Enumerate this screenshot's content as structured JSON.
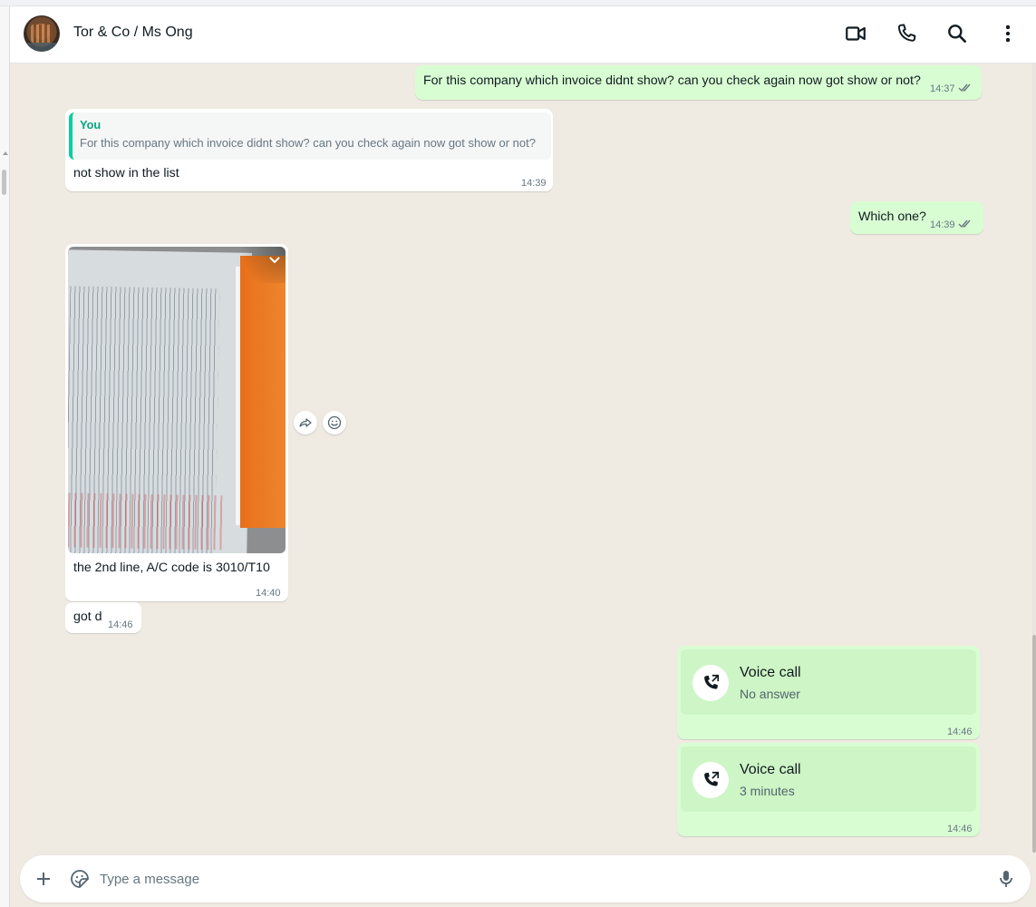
{
  "header": {
    "title": "Tor & Co / Ms Ong",
    "icons": [
      "video-call-icon",
      "voice-call-icon",
      "search-icon",
      "menu-icon"
    ]
  },
  "messages": [
    {
      "direction": "out",
      "text": "For this company which invoice didnt show? can you check again now got show or not?",
      "time": "14:37",
      "status": "read"
    },
    {
      "direction": "in",
      "quote": {
        "author": "You",
        "text": "For this company which invoice didnt show? can you check again now got show or not?"
      },
      "text": "not show in the list",
      "time": "14:39"
    },
    {
      "direction": "out",
      "text": "Which one?",
      "time": "14:39",
      "status": "read"
    },
    {
      "direction": "in",
      "type": "image",
      "caption": "the 2nd line, A/C code is 3010/T10",
      "time": "14:40"
    },
    {
      "direction": "in",
      "text": "got d",
      "time": "14:46"
    },
    {
      "direction": "out",
      "type": "call",
      "title": "Voice call",
      "subtitle": "No answer",
      "time": "14:46"
    },
    {
      "direction": "out",
      "type": "call",
      "title": "Voice call",
      "subtitle": "3 minutes",
      "time": "14:46"
    }
  ],
  "composer": {
    "placeholder": "Type a message"
  },
  "colors": {
    "background": "#efeae2",
    "outgoing": "#d9fdd3",
    "incoming": "#ffffff",
    "accent": "#06cf9c",
    "read_ticks": "#667781"
  }
}
